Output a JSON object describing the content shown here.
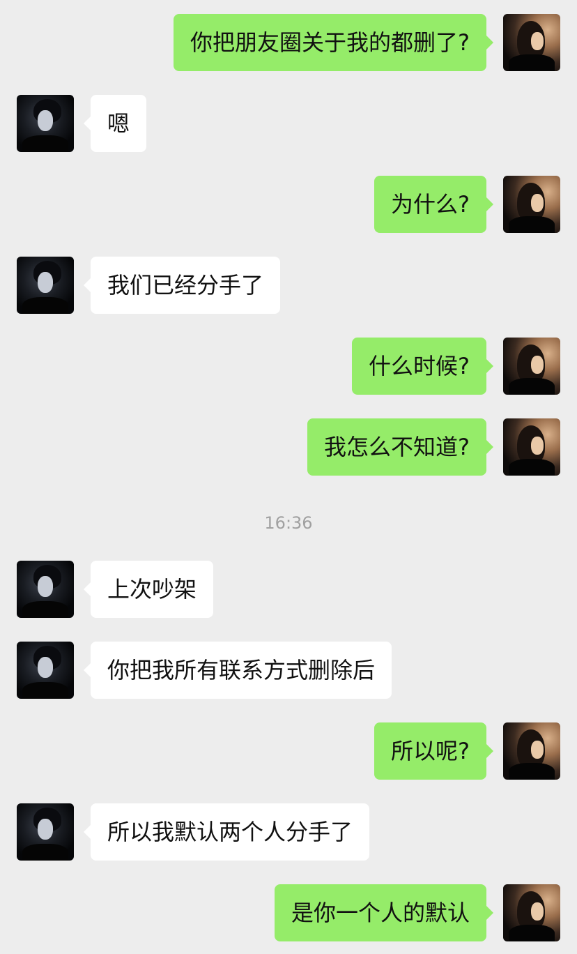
{
  "chat": {
    "messages": [
      {
        "side": "right",
        "text": "你把朋友圈关于我的都删了?"
      },
      {
        "side": "left",
        "text": "嗯"
      },
      {
        "side": "right",
        "text": "为什么?"
      },
      {
        "side": "left",
        "text": "我们已经分手了"
      },
      {
        "side": "right",
        "text": "什么时候?"
      },
      {
        "side": "right",
        "text": "我怎么不知道?"
      },
      {
        "side": "left",
        "text": "上次吵架"
      },
      {
        "side": "left",
        "text": "你把我所有联系方式删除后"
      },
      {
        "side": "right",
        "text": "所以呢?"
      },
      {
        "side": "left",
        "text": "所以我默认两个人分手了"
      },
      {
        "side": "right",
        "text": "是你一个人的默认"
      }
    ],
    "timestamp": "16:36"
  }
}
